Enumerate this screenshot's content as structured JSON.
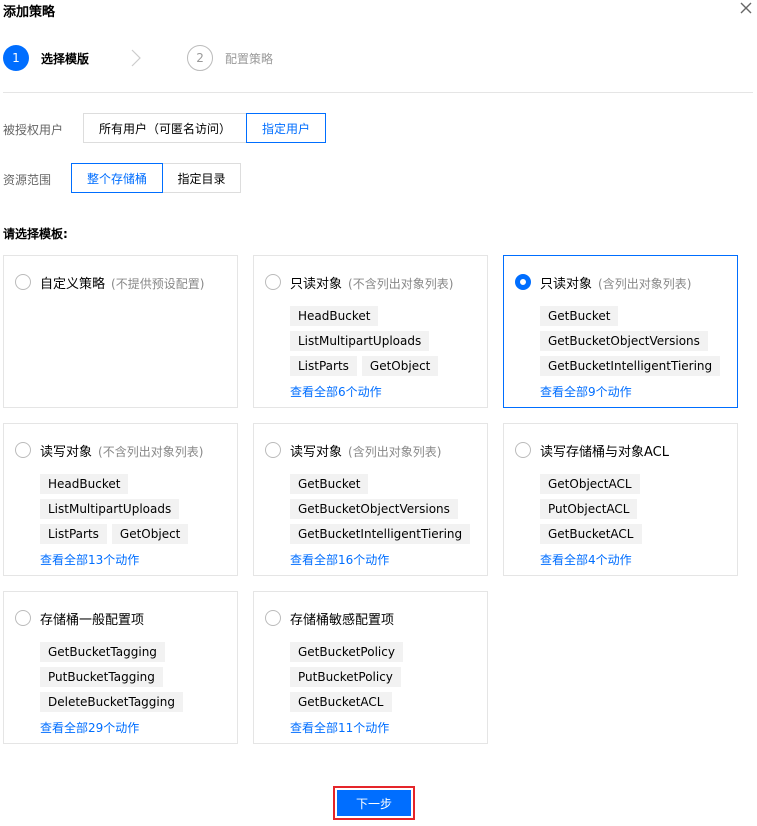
{
  "dialog": {
    "title": "添加策略"
  },
  "steps": [
    {
      "number": "1",
      "label": "选择模版"
    },
    {
      "number": "2",
      "label": "配置策略"
    }
  ],
  "authorized_user": {
    "label": "被授权用户",
    "options": [
      "所有用户（可匿名访问）",
      "指定用户"
    ],
    "selected": "指定用户"
  },
  "resource_scope": {
    "label": "资源范围",
    "options": [
      "整个存储桶",
      "指定目录"
    ],
    "selected": "整个存储桶"
  },
  "templates_title": "请选择模板:",
  "templates": [
    {
      "title": "自定义策略",
      "subtitle": "(不提供预设配置)",
      "tags": [],
      "more": "",
      "selected": false
    },
    {
      "title": "只读对象",
      "subtitle": "(不含列出对象列表)",
      "tags": [
        "HeadBucket",
        "ListMultipartUploads",
        "ListParts",
        "GetObject"
      ],
      "more": "查看全部6个动作",
      "selected": false
    },
    {
      "title": "只读对象",
      "subtitle": "(含列出对象列表)",
      "tags": [
        "GetBucket",
        "GetBucketObjectVersions",
        "GetBucketIntelligentTiering"
      ],
      "more": "查看全部9个动作",
      "selected": true
    },
    {
      "title": "读写对象",
      "subtitle": "(不含列出对象列表)",
      "tags": [
        "HeadBucket",
        "ListMultipartUploads",
        "ListParts",
        "GetObject"
      ],
      "more": "查看全部13个动作",
      "selected": false
    },
    {
      "title": "读写对象",
      "subtitle": "(含列出对象列表)",
      "tags": [
        "GetBucket",
        "GetBucketObjectVersions",
        "GetBucketIntelligentTiering"
      ],
      "more": "查看全部16个动作",
      "selected": false
    },
    {
      "title": "读写存储桶与对象ACL",
      "subtitle": "",
      "tags": [
        "GetObjectACL",
        "PutObjectACL",
        "GetBucketACL"
      ],
      "more": "查看全部4个动作",
      "selected": false
    },
    {
      "title": "存储桶一般配置项",
      "subtitle": "",
      "tags": [
        "GetBucketTagging",
        "PutBucketTagging",
        "DeleteBucketTagging"
      ],
      "more": "查看全部29个动作",
      "selected": false
    },
    {
      "title": "存储桶敏感配置项",
      "subtitle": "",
      "tags": [
        "GetBucketPolicy",
        "PutBucketPolicy",
        "GetBucketACL"
      ],
      "more": "查看全部11个动作",
      "selected": false
    }
  ],
  "footer": {
    "next_label": "下一步"
  },
  "colors": {
    "primary": "#006eff",
    "highlight_border": "#e5252a",
    "tag_bg": "#f2f2f2"
  }
}
